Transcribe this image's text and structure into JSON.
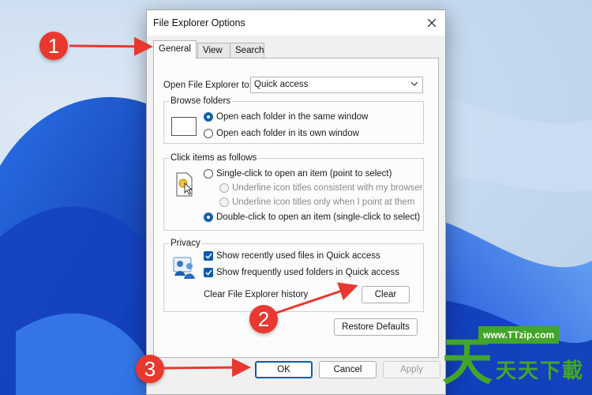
{
  "dialog": {
    "title": "File Explorer Options",
    "tabs": [
      {
        "label": "General",
        "active": true
      },
      {
        "label": "View",
        "active": false
      },
      {
        "label": "Search",
        "active": false
      }
    ],
    "open_to": {
      "label": "Open File Explorer to:",
      "value": "Quick access"
    },
    "browse_folders": {
      "legend": "Browse folders",
      "options": [
        {
          "label": "Open each folder in the same window",
          "checked": true
        },
        {
          "label": "Open each folder in its own window",
          "checked": false
        }
      ]
    },
    "click_items": {
      "legend": "Click items as follows",
      "single": {
        "label": "Single-click to open an item (point to select)",
        "checked": false
      },
      "underline_browser": {
        "label": "Underline icon titles consistent with my browser",
        "enabled": false
      },
      "underline_point": {
        "label": "Underline icon titles only when I point at them",
        "enabled": false
      },
      "double": {
        "label": "Double-click to open an item (single-click to select)",
        "checked": true
      }
    },
    "privacy": {
      "legend": "Privacy",
      "recent_files": {
        "label": "Show recently used files in Quick access",
        "checked": true
      },
      "frequent_folders": {
        "label": "Show frequently used folders in Quick access",
        "checked": true
      },
      "clear_history_label": "Clear File Explorer history",
      "clear_button": "Clear"
    },
    "restore_defaults": "Restore Defaults",
    "buttons": {
      "ok": "OK",
      "cancel": "Cancel",
      "apply": "Apply"
    }
  },
  "annotations": [
    "1",
    "2",
    "3"
  ],
  "watermark": {
    "url": "www.TTzip.com",
    "big_char": "天",
    "text": "天天下載"
  },
  "colors": {
    "accent": "#0b5cad",
    "annotation": "#e8382f",
    "watermark": "#43a52a"
  }
}
